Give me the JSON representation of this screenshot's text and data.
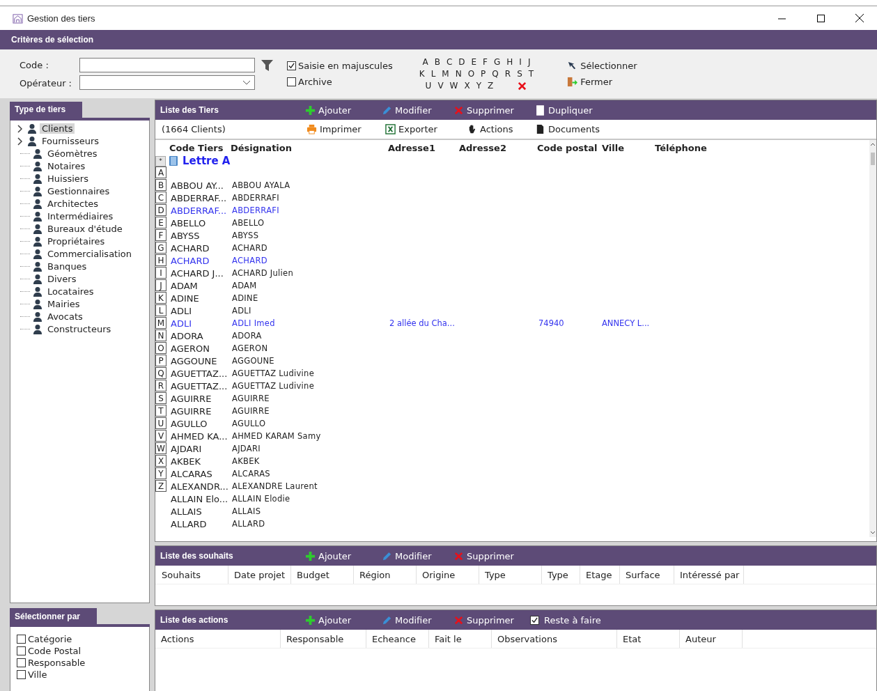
{
  "window": {
    "title": "Gestion des tiers"
  },
  "criteria": {
    "title": "Critères de sélection",
    "code_label": "Code :",
    "operator_label": "Opérateur :",
    "checkboxes": [
      {
        "label": "Saisie en majuscules",
        "checked": true
      },
      {
        "label": "Archive",
        "checked": false
      }
    ],
    "alphabet": [
      [
        "A",
        "B",
        "C",
        "D",
        "E",
        "F",
        "G",
        "H",
        "I",
        "J"
      ],
      [
        "K",
        "L",
        "M",
        "N",
        "O",
        "P",
        "Q",
        "R",
        "S",
        "T"
      ],
      [
        "U",
        "V",
        "W",
        "X",
        "Y",
        "Z"
      ]
    ],
    "actions": [
      {
        "label": "Sélectionner",
        "kind": "select"
      },
      {
        "label": "Fermer",
        "kind": "close"
      }
    ]
  },
  "tree": {
    "title": "Type de tiers",
    "items": [
      {
        "label": "Clients",
        "selected": true,
        "kind": "group"
      },
      {
        "label": "Fournisseurs",
        "selected": false,
        "kind": "group"
      },
      {
        "label": "Géomètres",
        "selected": false,
        "kind": "leaf"
      },
      {
        "label": "Notaires",
        "selected": false,
        "kind": "leaf"
      },
      {
        "label": "Huissiers",
        "selected": false,
        "kind": "leaf"
      },
      {
        "label": "Gestionnaires",
        "selected": false,
        "kind": "leaf"
      },
      {
        "label": "Architectes",
        "selected": false,
        "kind": "leaf"
      },
      {
        "label": "Intermédiaires",
        "selected": false,
        "kind": "leaf"
      },
      {
        "label": "Bureaux d'étude",
        "selected": false,
        "kind": "leaf"
      },
      {
        "label": "Propriétaires",
        "selected": false,
        "kind": "leaf"
      },
      {
        "label": "Commercialisation",
        "selected": false,
        "kind": "leaf"
      },
      {
        "label": "Banques",
        "selected": false,
        "kind": "leaf"
      },
      {
        "label": "Divers",
        "selected": false,
        "kind": "leaf"
      },
      {
        "label": "Locataires",
        "selected": false,
        "kind": "leaf"
      },
      {
        "label": "Mairies",
        "selected": false,
        "kind": "leaf"
      },
      {
        "label": "Avocats",
        "selected": false,
        "kind": "leaf"
      },
      {
        "label": "Constructeurs",
        "selected": false,
        "kind": "leaf"
      }
    ]
  },
  "select_by": {
    "title": "Sélectionner par",
    "options": [
      {
        "label": "Catégorie",
        "checked": false
      },
      {
        "label": "Code Postal",
        "checked": false
      },
      {
        "label": "Responsable",
        "checked": false
      },
      {
        "label": "Ville",
        "checked": false
      }
    ]
  },
  "tiers": {
    "title": "Liste des Tiers",
    "toolbar": [
      {
        "label": "Ajouter",
        "kind": "add"
      },
      {
        "label": "Modifier",
        "kind": "edit"
      },
      {
        "label": "Supprimer",
        "kind": "delete"
      },
      {
        "label": "Dupliquer",
        "kind": "duplicate"
      }
    ],
    "count": "(1664 Clients)",
    "toolbar2": [
      {
        "label": "Imprimer",
        "kind": "print"
      },
      {
        "label": "Exporter",
        "kind": "export"
      },
      {
        "label": "Actions",
        "kind": "hand"
      },
      {
        "label": "Documents",
        "kind": "document"
      }
    ],
    "columns": [
      "Code Tiers",
      "Désignation",
      "Adresse1",
      "Adresse2",
      "Code postal",
      "Ville",
      "Téléphone"
    ],
    "group_marker": "*",
    "group": "Lettre A",
    "letters": [
      "A",
      "B",
      "C",
      "D",
      "E",
      "F",
      "G",
      "H",
      "I",
      "J",
      "K",
      "L",
      "M",
      "N",
      "O",
      "P",
      "Q",
      "R",
      "S",
      "T",
      "U",
      "V",
      "W",
      "X",
      "Y",
      "Z"
    ],
    "rows": [
      {
        "code": "ABBOU AY...",
        "designation": "ABBOU AYALA",
        "highlighted": false
      },
      {
        "code": "ABDERRAF...",
        "designation": "ABDERRAFI",
        "highlighted": false
      },
      {
        "code": "ABDERRAF...",
        "designation": "ABDERRAFI",
        "highlighted": true
      },
      {
        "code": "ABELLO",
        "designation": "ABELLO",
        "highlighted": false
      },
      {
        "code": "ABYSS",
        "designation": "ABYSS",
        "highlighted": false
      },
      {
        "code": "ACHARD",
        "designation": "ACHARD",
        "highlighted": false
      },
      {
        "code": "ACHARD",
        "designation": "ACHARD",
        "highlighted": true
      },
      {
        "code": "ACHARD J...",
        "designation": "ACHARD Julien",
        "highlighted": false
      },
      {
        "code": "ADAM",
        "designation": "ADAM",
        "highlighted": false
      },
      {
        "code": "ADINE",
        "designation": "ADINE",
        "highlighted": false
      },
      {
        "code": "ADLI",
        "designation": "ADLI",
        "highlighted": false
      },
      {
        "code": "ADLI",
        "designation": "ADLI Imed",
        "adresse1": "2 allée du Cha...",
        "code_postal": "74940",
        "ville": "ANNECY L...",
        "highlighted": true
      },
      {
        "code": "ADORA",
        "designation": "ADORA",
        "highlighted": false
      },
      {
        "code": "AGERON",
        "designation": "AGERON",
        "highlighted": false
      },
      {
        "code": "AGGOUNE",
        "designation": "AGGOUNE",
        "highlighted": false
      },
      {
        "code": "AGUETTAZ...",
        "designation": "AGUETTAZ Ludivine",
        "highlighted": false
      },
      {
        "code": "AGUETTAZ...",
        "designation": "AGUETTAZ Ludivine",
        "highlighted": false
      },
      {
        "code": "AGUIRRE",
        "designation": "AGUIRRE",
        "highlighted": false
      },
      {
        "code": "AGUIRRE",
        "designation": "AGUIRRE",
        "highlighted": false
      },
      {
        "code": "AGULLO",
        "designation": "AGULLO",
        "highlighted": false
      },
      {
        "code": "AHMED KA...",
        "designation": "AHMED KARAM Samy",
        "highlighted": false
      },
      {
        "code": "AJDARI",
        "designation": "AJDARI",
        "highlighted": false
      },
      {
        "code": "AKBEK",
        "designation": "AKBEK",
        "highlighted": false
      },
      {
        "code": "ALCARAS",
        "designation": "ALCARAS",
        "highlighted": false
      },
      {
        "code": "ALEXANDR...",
        "designation": "ALEXANDRE Laurent",
        "highlighted": false
      },
      {
        "code": "ALLAIN Elo...",
        "designation": "ALLAIN Elodie",
        "highlighted": false
      },
      {
        "code": "ALLAIS",
        "designation": "ALLAIS",
        "highlighted": false
      },
      {
        "code": "ALLARD",
        "designation": "ALLARD",
        "highlighted": false
      }
    ]
  },
  "souhaits": {
    "title": "Liste des souhaits",
    "toolbar": [
      {
        "label": "Ajouter",
        "kind": "add"
      },
      {
        "label": "Modifier",
        "kind": "edit"
      },
      {
        "label": "Supprimer",
        "kind": "delete"
      }
    ],
    "columns": [
      "Souhaits",
      "Date projet",
      "Budget",
      "Région",
      "Origine",
      "Type",
      "Type",
      "Etage",
      "Surface",
      "Intéressé par"
    ]
  },
  "actions": {
    "title": "Liste des actions",
    "toolbar": [
      {
        "label": "Ajouter",
        "kind": "add"
      },
      {
        "label": "Modifier",
        "kind": "edit"
      },
      {
        "label": "Supprimer",
        "kind": "delete"
      }
    ],
    "reste": {
      "label": "Reste à faire",
      "checked": true
    },
    "columns": [
      "Actions",
      "Responsable",
      "Echeance",
      "Fait le",
      "Observations",
      "Etat",
      "Auteur"
    ]
  }
}
